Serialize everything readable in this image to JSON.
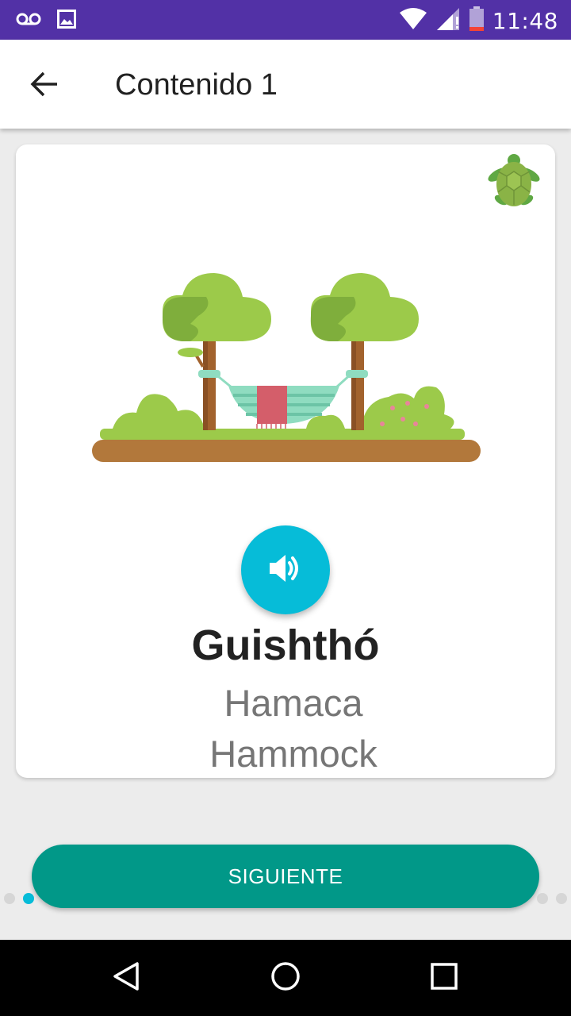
{
  "status_bar": {
    "time": "11:48",
    "icons": [
      "voicemail-icon",
      "image-icon",
      "wifi-icon",
      "signal-icon",
      "battery-icon"
    ],
    "background": "#5231a6"
  },
  "app_bar": {
    "title": "Contenido 1",
    "back_icon": "arrow-back-icon"
  },
  "card": {
    "badge_icon": "turtle-icon",
    "illustration": "hammock-between-trees",
    "audio_icon": "volume-icon",
    "word": "Guishthó",
    "translation_es": "Hamaca",
    "translation_en": "Hammock"
  },
  "next_button": {
    "label": "SIGUIENTE"
  },
  "pager": {
    "total_dots": 4,
    "active_index": 1
  },
  "colors": {
    "accent": "#06bcd8",
    "primary_button": "#019888",
    "status_bar": "#5231a6"
  },
  "nav_bar": {
    "buttons": [
      "back-triangle-icon",
      "home-circle-icon",
      "recents-square-icon"
    ]
  }
}
